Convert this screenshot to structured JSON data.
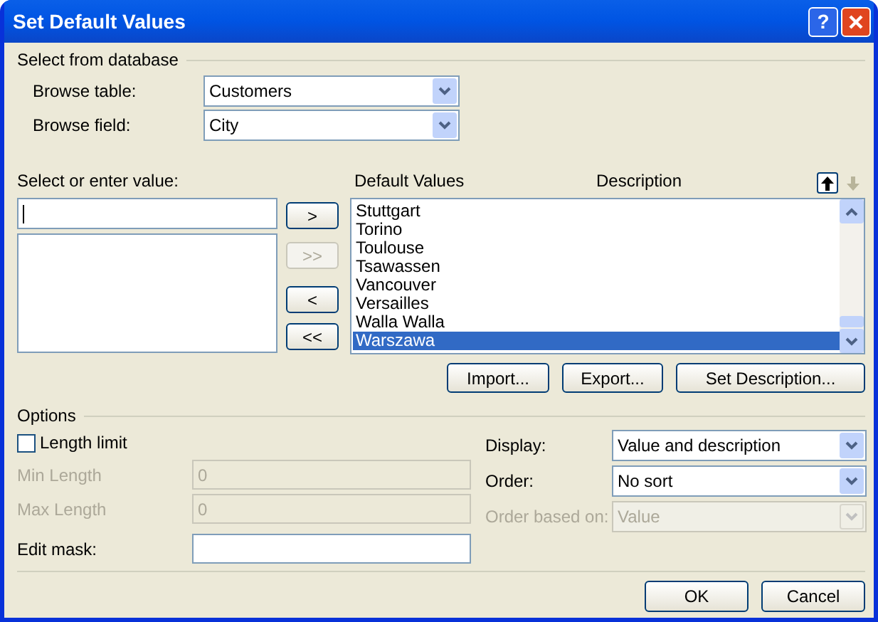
{
  "window": {
    "title": "Set Default Values",
    "help": "?"
  },
  "database": {
    "heading": "Select from database",
    "fields": [
      {
        "label": "Browse table:",
        "value": "Customers"
      },
      {
        "label": "Browse field:",
        "value": "City"
      }
    ]
  },
  "value_entry": {
    "label": "Select or enter value:"
  },
  "transfer_buttons": [
    {
      "label": ">",
      "disabled": false
    },
    {
      "label": ">>",
      "disabled": true
    },
    {
      "label": "<",
      "disabled": false
    },
    {
      "label": "<<",
      "disabled": false
    }
  ],
  "default_values": {
    "columns": [
      "Default Values",
      "Description"
    ],
    "move_up": {
      "disabled": false
    },
    "move_down": {
      "disabled": true
    },
    "rows": [
      {
        "value": "Stuttgart",
        "selected": false
      },
      {
        "value": "Torino",
        "selected": false
      },
      {
        "value": "Toulouse",
        "selected": false
      },
      {
        "value": "Tsawassen",
        "selected": false
      },
      {
        "value": "Vancouver",
        "selected": false
      },
      {
        "value": "Versailles",
        "selected": false
      },
      {
        "value": "Walla Walla",
        "selected": false
      },
      {
        "value": "Warszawa",
        "selected": true
      }
    ]
  },
  "list_buttons": [
    "Import...",
    "Export...",
    "Set Description..."
  ],
  "options": {
    "heading": "Options",
    "length_limit": {
      "label": "Length limit",
      "checked": false
    },
    "fields": [
      {
        "label": "Min Length",
        "value": "0",
        "disabled": true
      },
      {
        "label": "Max Length",
        "value": "0",
        "disabled": true
      },
      {
        "label": "Edit mask:",
        "disabled": false
      }
    ],
    "selects": [
      {
        "label": "Display:",
        "value": "Value and description",
        "disabled": false
      },
      {
        "label": "Order:",
        "value": "No sort",
        "disabled": false
      },
      {
        "label": "Order based on:",
        "value": "Value",
        "disabled": true
      }
    ]
  },
  "buttons": [
    "OK",
    "Cancel"
  ]
}
